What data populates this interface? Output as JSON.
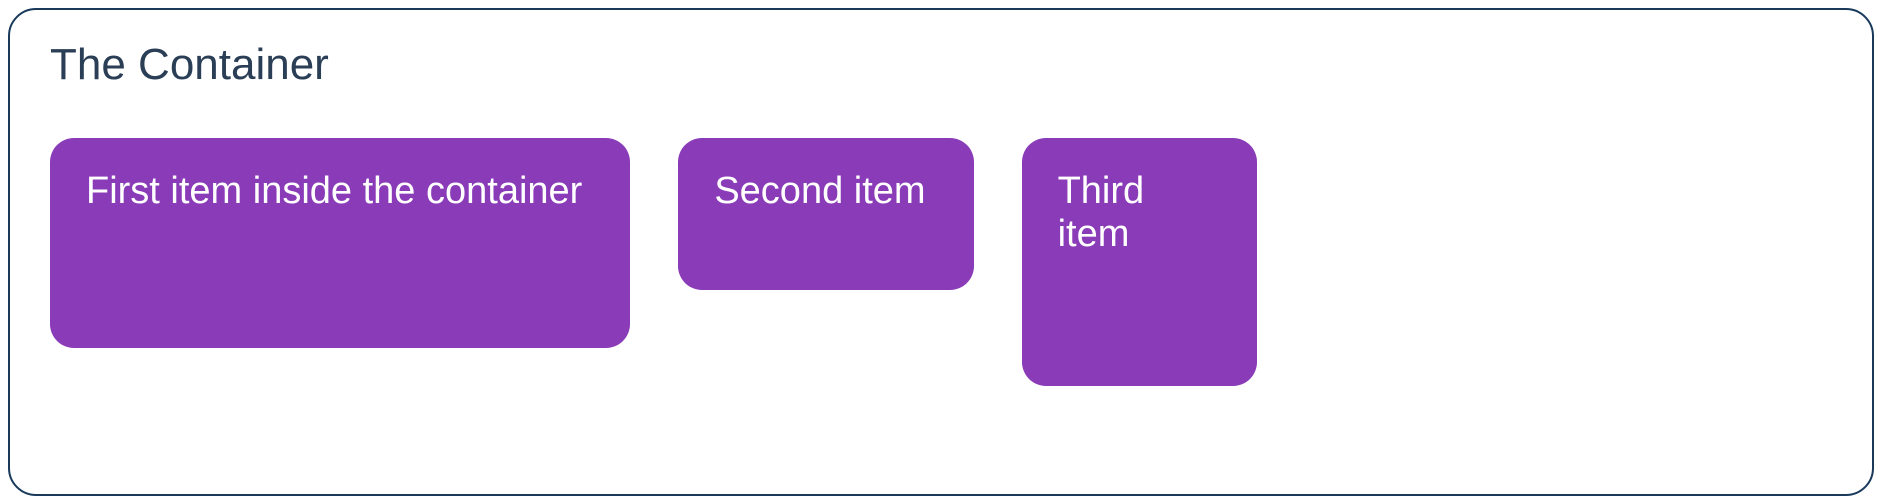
{
  "container": {
    "title": "The Container",
    "items": [
      {
        "label": "First item inside the container"
      },
      {
        "label": "Second item"
      },
      {
        "label": "Third item"
      }
    ]
  },
  "colors": {
    "border": "#1a3a5c",
    "title": "#2a3e56",
    "item_bg": "#8a3bb8",
    "item_text": "#ffffff"
  }
}
